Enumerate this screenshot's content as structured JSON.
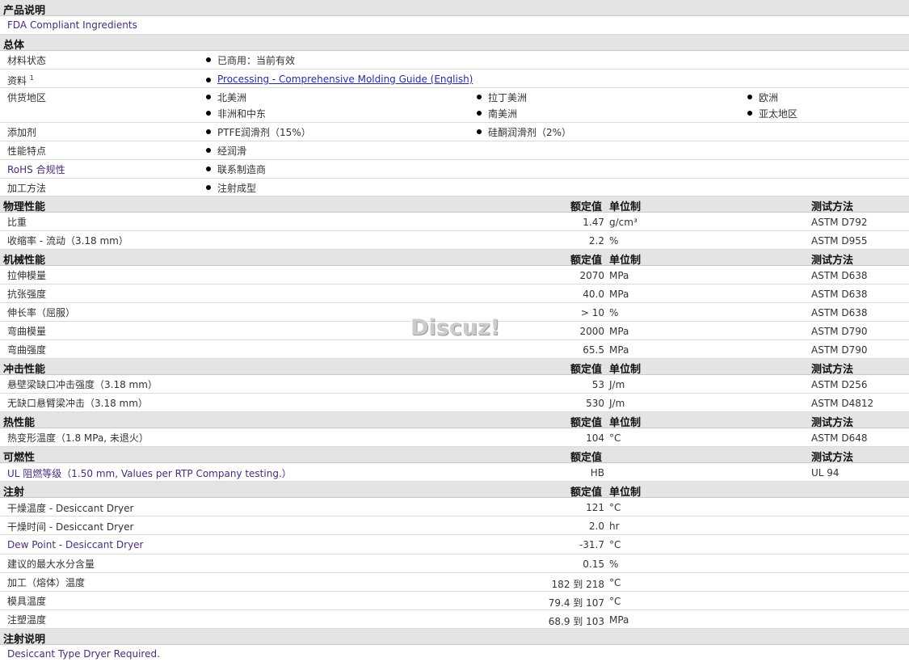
{
  "sections": {
    "product_desc": "产品说明",
    "general": "总体",
    "physical": "物理性能",
    "mechanical": "机械性能",
    "impact": "冲击性能",
    "thermal": "热性能",
    "flammability": "可燃性",
    "injection": "注射",
    "injection_notes": "注射说明"
  },
  "headers": {
    "nominal": "额定值",
    "unit": "单位制",
    "method": "测试方法"
  },
  "product_desc_text": "FDA Compliant Ingredients",
  "general": {
    "material_status_label": "材料状态",
    "material_status_value": "已商用：当前有效",
    "documents_label": "资料",
    "documents_sup": "1",
    "documents_link": "Processing - Comprehensive Molding Guide (English)",
    "supply_label": "供货地区",
    "supply_regions": [
      "北美洲",
      "拉丁美洲",
      "欧洲",
      "非洲和中东",
      "南美洲",
      "亚太地区"
    ],
    "additives_label": "添加剂",
    "additives": [
      "PTFE润滑剂（15%）",
      "硅酮润滑剂（2%）"
    ],
    "features_label": "性能特点",
    "features_value": "经润滑",
    "rohs_label": "RoHS 合规性",
    "rohs_value": "联系制造商",
    "processing_label": "加工方法",
    "processing_value": "注射成型"
  },
  "physical": [
    {
      "name": "比重",
      "value": "1.47",
      "unit": "g/cm³",
      "method": "ASTM D792"
    },
    {
      "name": "收缩率 - 流动（3.18 mm）",
      "value": "2.2",
      "unit": "%",
      "method": "ASTM D955"
    }
  ],
  "mechanical": [
    {
      "name": "拉伸模量",
      "value": "2070",
      "unit": "MPa",
      "method": "ASTM D638"
    },
    {
      "name": "抗张强度",
      "value": "40.0",
      "unit": "MPa",
      "method": "ASTM D638"
    },
    {
      "name": "伸长率（屈服）",
      "value": "> 10",
      "unit": "%",
      "method": "ASTM D638"
    },
    {
      "name": "弯曲模量",
      "value": "2000",
      "unit": "MPa",
      "method": "ASTM D790"
    },
    {
      "name": "弯曲强度",
      "value": "65.5",
      "unit": "MPa",
      "method": "ASTM D790"
    }
  ],
  "impact": [
    {
      "name": "悬壁梁缺口冲击强度（3.18 mm）",
      "value": "53",
      "unit": "J/m",
      "method": "ASTM D256"
    },
    {
      "name": "无缺口悬臂梁冲击（3.18 mm）",
      "value": "530",
      "unit": "J/m",
      "method": "ASTM D4812"
    }
  ],
  "thermal": [
    {
      "name": "热变形温度（1.8 MPa, 未退火）",
      "value": "104",
      "unit": "°C",
      "method": "ASTM D648"
    }
  ],
  "flammability": [
    {
      "name": "UL 阻燃等级（1.50 mm, Values per RTP Company testing.）",
      "value": "HB",
      "unit": "",
      "method": "UL 94"
    }
  ],
  "injection": [
    {
      "name": "干燥温度 - Desiccant Dryer",
      "value": "121",
      "unit": "°C"
    },
    {
      "name": "干燥时间 - Desiccant Dryer",
      "value": "2.0",
      "unit": "hr"
    },
    {
      "name": "Dew Point - Desiccant Dryer",
      "value": "-31.7",
      "unit": "°C"
    },
    {
      "name": "建议的最大水分含量",
      "value": "0.15",
      "unit": "%"
    },
    {
      "name": "加工（熔体）温度",
      "value": "182 到 218",
      "unit": "°C"
    },
    {
      "name": "模具温度",
      "value": "79.4 到 107",
      "unit": "°C"
    },
    {
      "name": "注塑温度",
      "value": "68.9 到 103",
      "unit": "MPa"
    }
  ],
  "injection_notes_text": "Desiccant Type Dryer Required.",
  "watermark": "Discuz!"
}
